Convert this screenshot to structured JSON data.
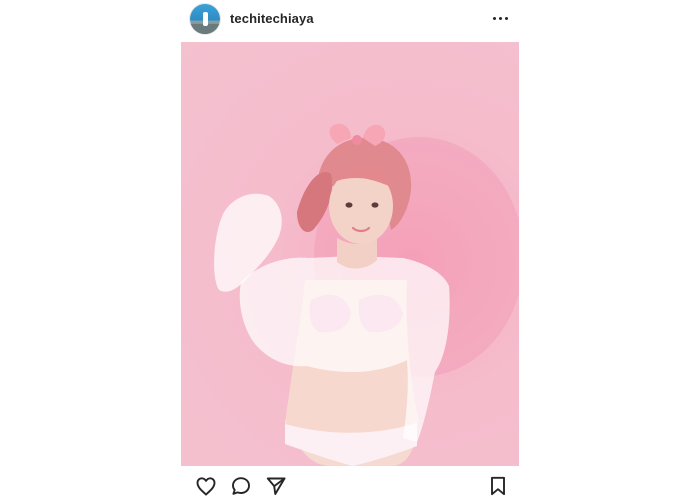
{
  "post": {
    "username": "techitechiaya",
    "avatar": "profile-avatar",
    "more_icon": "more-options-icon",
    "photo_description_icon": "post-photo"
  },
  "actions": {
    "like_icon": "heart-icon",
    "comment_icon": "comment-icon",
    "share_icon": "send-icon",
    "save_icon": "bookmark-icon"
  },
  "colors": {
    "photo_background": "#f4c1cf",
    "text": "#262626",
    "icon": "#262626"
  }
}
